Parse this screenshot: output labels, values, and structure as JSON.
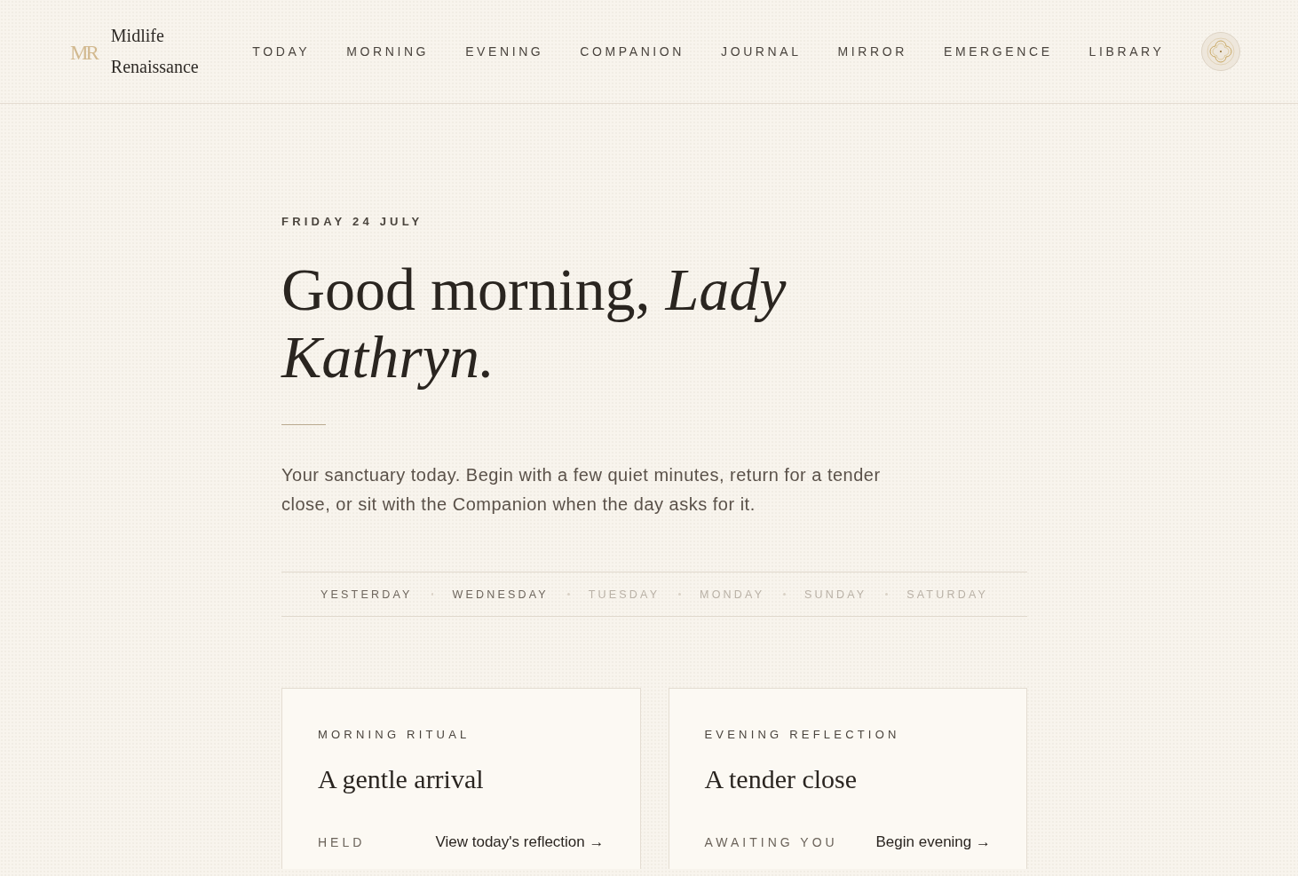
{
  "header": {
    "logo": {
      "monogram": "MR",
      "name": "Midlife Renaissance"
    },
    "nav": [
      "TODAY",
      "MORNING",
      "EVENING",
      "COMPANION",
      "JOURNAL",
      "MIRROR",
      "EMERGENCE",
      "LIBRARY"
    ]
  },
  "greeting": {
    "date": "FRIDAY 24 JULY",
    "heading": "Good morning, *Lady Kathryn.*",
    "intro": "Your sanctuary today. Begin with a few quiet minutes, return for a tender close, or sit with the Companion when the day asks for it."
  },
  "days": [
    {
      "label": "YESTERDAY",
      "disabled": false
    },
    {
      "label": "WEDNESDAY",
      "disabled": false
    },
    {
      "label": "TUESDAY",
      "disabled": true
    },
    {
      "label": "MONDAY",
      "disabled": true
    },
    {
      "label": "SUNDAY",
      "disabled": true
    },
    {
      "label": "SATURDAY",
      "disabled": true
    }
  ],
  "cards": [
    {
      "label": "MORNING RITUAL",
      "title": "A gentle arrival",
      "status": "HELD",
      "link": "View today's reflection →"
    },
    {
      "label": "EVENING REFLECTION",
      "title": "A tender close",
      "status": "AWAITING YOU",
      "link": "Begin evening →"
    }
  ]
}
